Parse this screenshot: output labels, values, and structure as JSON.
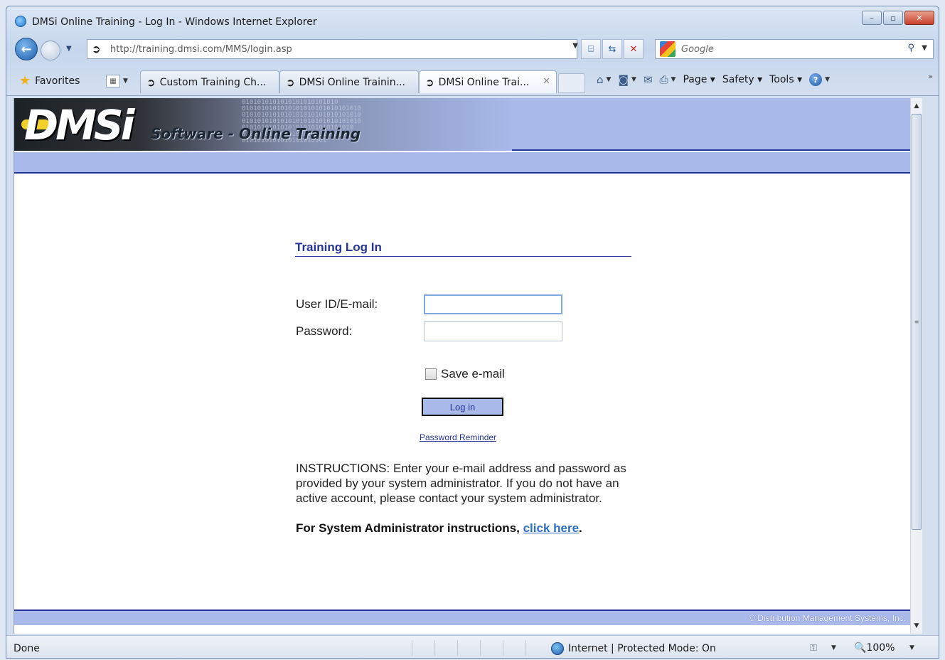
{
  "window": {
    "title": "DMSi Online Training - Log In - Windows Internet Explorer",
    "minimize": "–",
    "restore": "▫",
    "close": "✕"
  },
  "nav": {
    "url": "http://training.dmsi.com/MMS/login.asp",
    "search_placeholder": "Google"
  },
  "tabbar": {
    "favorites": "Favorites",
    "tabs": [
      {
        "label": "Custom Training Ch..."
      },
      {
        "label": "DMSi Online Trainin..."
      },
      {
        "label": "DMSi Online Trai..."
      }
    ],
    "commands": {
      "page": "Page",
      "safety": "Safety",
      "tools": "Tools"
    }
  },
  "banner": {
    "logo": "DMSi",
    "tagline": "Software - Online Training"
  },
  "login": {
    "heading": "Training Log In",
    "user_label": "User ID/E-mail:",
    "password_label": "Password:",
    "user_value": "",
    "password_value": "",
    "save_label": "Save e-mail",
    "login_button": "Log in",
    "reminder_link": "Password Reminder",
    "instructions": "INSTRUCTIONS: Enter your e-mail address and password as provided by your system administrator. If you do not have an active account, please contact your system administrator.",
    "sysadmin_prefix": "For System Administrator instructions, ",
    "sysadmin_link": "click here",
    "sysadmin_suffix": "."
  },
  "footer": {
    "copyright": "© Distribution Management Systems, Inc."
  },
  "status": {
    "text": "Done",
    "zone": "Internet | Protected Mode: On",
    "zoom": "100%"
  },
  "colors": {
    "brand_navy": "#25349a",
    "brand_periwinkle": "#a8b9ea",
    "link_blue": "#2a6fc4"
  }
}
